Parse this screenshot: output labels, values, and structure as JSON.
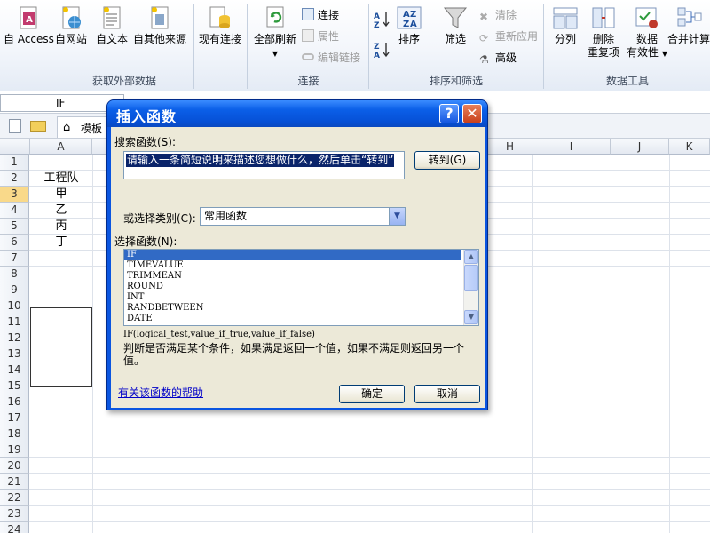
{
  "ribbon": {
    "buttons": {
      "access": "自 Access",
      "web": "自网站",
      "text": "自文本",
      "other": "自其他来源",
      "existing": "现有连接",
      "refresh_all": "全部刷新",
      "sort": "排序",
      "filter": "筛选",
      "split": "分列",
      "remove_dup_1": "删除",
      "remove_dup_2": "重复项",
      "validation_1": "数据",
      "validation_2": "有效性",
      "consolidate": "合并计算"
    },
    "small": {
      "connections": "连接",
      "properties": "属性",
      "edit_links": "编辑链接",
      "clear": "清除",
      "reapply": "重新应用",
      "advanced": "高级"
    },
    "groups": {
      "external": "获取外部数据",
      "connections": "连接",
      "sort_filter": "排序和筛选",
      "data_tools": "数据工具"
    }
  },
  "formula_bar": {
    "name_box": "IF"
  },
  "toolbar": {
    "tab_label": "模板"
  },
  "grid": {
    "columns": [
      "A",
      "H",
      "I",
      "J",
      "K"
    ],
    "rows": [
      "1",
      "2",
      "3",
      "4",
      "5",
      "6",
      "7",
      "8",
      "9",
      "10",
      "11",
      "12",
      "13",
      "14",
      "15",
      "16",
      "17",
      "18",
      "19",
      "20",
      "21",
      "22",
      "23",
      "24"
    ],
    "cells": [
      "工程队",
      "甲",
      "乙",
      "丙",
      "丁"
    ]
  },
  "dialog": {
    "title": "插入函数",
    "help_glyph": "?",
    "close_glyph": "✕",
    "search_label": "搜索函数(S):",
    "search_value": "请输入一条简短说明来描述您想做什么，然后单击“转到”",
    "go_button": "转到(G)",
    "category_label": "或选择类别(C):",
    "category_value": "常用函数",
    "function_label": "选择函数(N):",
    "functions": [
      "IF",
      "TIMEVALUE",
      "TRIMMEAN",
      "ROUND",
      "INT",
      "RANDBETWEEN",
      "DATE"
    ],
    "syntax": "IF(logical_test,value_if_true,value_if_false)",
    "description": "判断是否满足某个条件，如果满足返回一个值，如果不满足则返回另一个值。",
    "help_link": "有关该函数的帮助",
    "ok": "确定",
    "cancel": "取消"
  }
}
